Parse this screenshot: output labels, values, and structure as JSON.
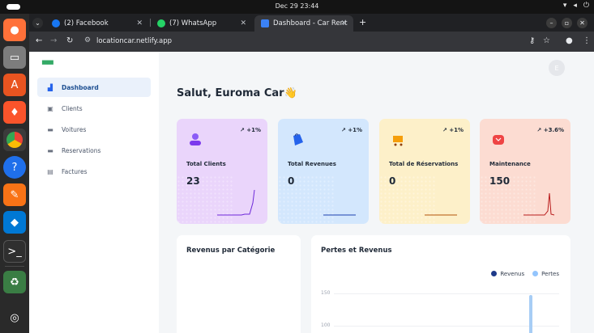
{
  "os": {
    "clock": "Dec 29  23:44",
    "dock": [
      "firefox-icon",
      "files-icon",
      "app-center-icon",
      "brave-icon",
      "chrome-icon",
      "help-icon",
      "pen-icon",
      "vscode-icon",
      "terminal-icon",
      "trash-icon",
      "ubuntu-icon"
    ]
  },
  "browser": {
    "tabs": [
      {
        "label": "(2) Facebook",
        "favicon_color": "#1877f2"
      },
      {
        "label": "(7) WhatsApp",
        "favicon_color": "#25d366"
      },
      {
        "label": "Dashboard - Car Rental A",
        "favicon_color": "#3b82f6"
      }
    ],
    "url": "locationcar.netlify.app"
  },
  "sidebar": {
    "items": [
      {
        "label": "Dashboard",
        "icon": "chart-icon",
        "active": true
      },
      {
        "label": "Clients",
        "icon": "user-icon",
        "active": false
      },
      {
        "label": "Voitures",
        "icon": "car-icon",
        "active": false
      },
      {
        "label": "Reservations",
        "icon": "truck-icon",
        "active": false
      },
      {
        "label": "Factures",
        "icon": "invoice-icon",
        "active": false
      }
    ]
  },
  "header": {
    "greeting": "Salut, Euroma Car👋",
    "avatar_initial": "E"
  },
  "cards": [
    {
      "label": "Total Clients",
      "value": "23",
      "trend": "+1%",
      "icon": "user-icon",
      "bg": "#ead5fb",
      "line": "#6d28d9"
    },
    {
      "label": "Total Revenues",
      "value": "0",
      "trend": "+1%",
      "icon": "bag-icon",
      "bg": "#d3e7fd",
      "line": "#1e40af"
    },
    {
      "label": "Total de Réservations",
      "value": "0",
      "trend": "+1%",
      "icon": "cart-icon",
      "bg": "#fdf0c9",
      "line": "#b45309"
    },
    {
      "label": "Maintenance",
      "value": "150",
      "trend": "+3.6%",
      "icon": "tool-icon",
      "bg": "#fcdcd2",
      "line": "#b91c1c"
    }
  ],
  "panels": {
    "category_title": "Revenus par Catégorie",
    "pl_title": "Pertes et Revenus",
    "legend": [
      {
        "label": "Revenus",
        "color": "#1e3a8a"
      },
      {
        "label": "Pertes",
        "color": "#93c5fd"
      }
    ],
    "yticks": [
      "150",
      "100"
    ]
  },
  "colors": {
    "accent": "#2563eb"
  }
}
